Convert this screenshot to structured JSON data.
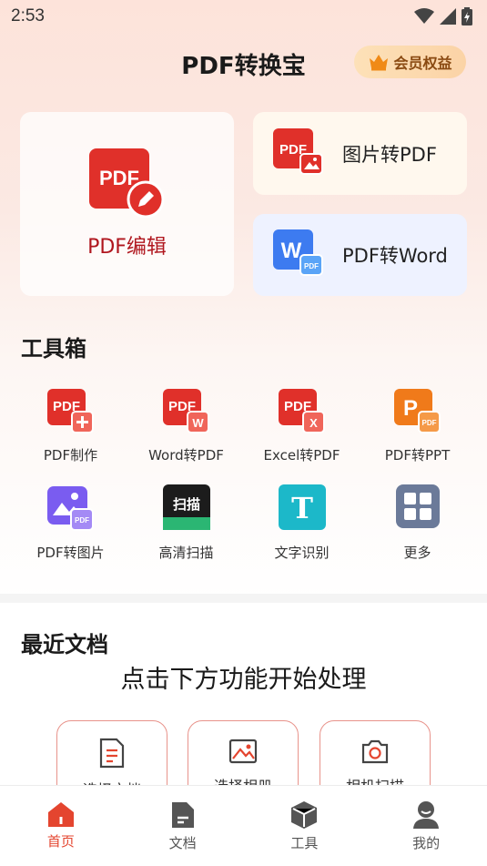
{
  "status": {
    "time": "2:53"
  },
  "header": {
    "title": "PDF转换宝",
    "vip_label": "会员权益"
  },
  "feature_cards": {
    "edit": {
      "label": "PDF编辑",
      "icon": "pdf-edit-icon"
    },
    "image_to_pdf": {
      "label": "图片转PDF",
      "icon": "pdf-image-icon"
    },
    "pdf_to_word": {
      "label": "PDF转Word",
      "icon": "word-pdf-icon"
    }
  },
  "toolbox": {
    "title": "工具箱",
    "items": [
      {
        "label": "PDF制作",
        "icon": "pdf-plus-icon"
      },
      {
        "label": "Word转PDF",
        "icon": "pdf-word-icon"
      },
      {
        "label": "Excel转PDF",
        "icon": "pdf-excel-icon"
      },
      {
        "label": "PDF转PPT",
        "icon": "ppt-pdf-icon"
      },
      {
        "label": "PDF转图片",
        "icon": "image-pdf-icon"
      },
      {
        "label": "高清扫描",
        "icon": "scan-icon",
        "badge": "扫描"
      },
      {
        "label": "文字识别",
        "icon": "text-ocr-icon",
        "badge": "T"
      },
      {
        "label": "更多",
        "icon": "grid-more-icon"
      }
    ]
  },
  "recent": {
    "title": "最近文档",
    "empty_hint": "点击下方功能开始处理",
    "actions": [
      {
        "label": "选择文档",
        "icon": "document-icon"
      },
      {
        "label": "选择相册",
        "icon": "album-icon"
      },
      {
        "label": "相机扫描",
        "icon": "camera-icon"
      }
    ]
  },
  "tabbar": {
    "items": [
      {
        "label": "首页",
        "icon": "home-icon",
        "active": true
      },
      {
        "label": "文档",
        "icon": "file-icon",
        "active": false
      },
      {
        "label": "工具",
        "icon": "cube-icon",
        "active": false
      },
      {
        "label": "我的",
        "icon": "user-icon",
        "active": false
      }
    ]
  },
  "colors": {
    "brand_red": "#e4452f",
    "pdf_red": "#e0302a",
    "word_blue": "#3d7bf0",
    "ppt_orange": "#f07a1a",
    "purple": "#7a5cf0",
    "teal": "#1cb8c9"
  }
}
